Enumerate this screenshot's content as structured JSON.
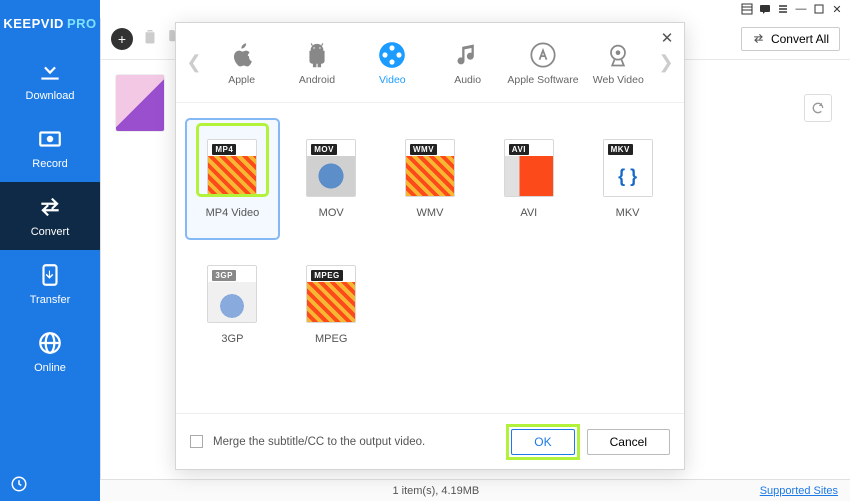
{
  "brand": {
    "name": "KEEPVID",
    "suffix": "PRO"
  },
  "sidebar": {
    "items": [
      {
        "label": "Download"
      },
      {
        "label": "Record"
      },
      {
        "label": "Convert"
      },
      {
        "label": "Transfer"
      },
      {
        "label": "Online"
      }
    ]
  },
  "toolbar": {
    "convert_all": "Convert All"
  },
  "modal": {
    "categories": [
      {
        "label": "Apple"
      },
      {
        "label": "Android"
      },
      {
        "label": "Video"
      },
      {
        "label": "Audio"
      },
      {
        "label": "Apple Software"
      },
      {
        "label": "Web Video"
      }
    ],
    "formats": [
      {
        "tag": "MP4",
        "label": "MP4 Video",
        "key": "mp4"
      },
      {
        "tag": "MOV",
        "label": "MOV",
        "key": "mov"
      },
      {
        "tag": "WMV",
        "label": "WMV",
        "key": "wmv"
      },
      {
        "tag": "AVI",
        "label": "AVI",
        "key": "avi"
      },
      {
        "tag": "MKV",
        "label": "MKV",
        "key": "mkv"
      },
      {
        "tag": "3GP",
        "label": "3GP",
        "key": "3gp"
      },
      {
        "tag": "MPEG",
        "label": "MPEG",
        "key": "mpeg"
      }
    ],
    "merge_label": "Merge the subtitle/CC to the output video.",
    "ok": "OK",
    "cancel": "Cancel"
  },
  "status": {
    "text": "1 item(s), 4.19MB",
    "link": "Supported Sites"
  }
}
